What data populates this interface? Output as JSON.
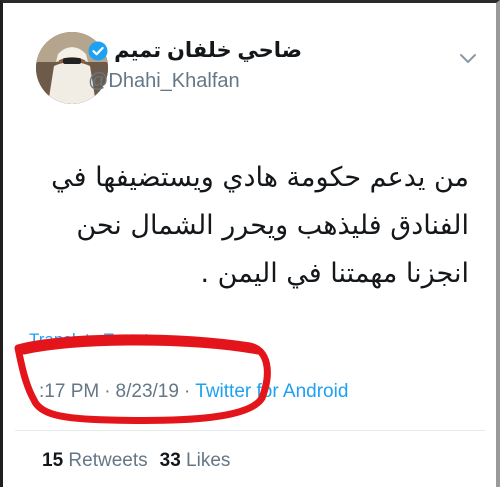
{
  "tweet": {
    "display_name": "ضاحي خلفان تميم",
    "handle": "@Dhahi_Khalfan",
    "verified_icon": "verified-badge-icon",
    "menu_icon": "chevron-down-icon",
    "body_lines": [
      "من يدعم حكومة هادي ويستضيفها في",
      "الفنادق فليذهب ويحرر الشمال نحن",
      "انجزنا مهمتنا في اليمن ."
    ],
    "translate_label": "Translate Tweet",
    "time": ":17 PM",
    "date": "8/23/19",
    "separator": "·",
    "source": "Twitter for Android",
    "retweets_count": "15",
    "retweets_label": "Retweets",
    "likes_count": "33",
    "likes_label": "Likes"
  },
  "colors": {
    "link_blue": "#1da1f2",
    "muted_gray": "#657786",
    "text": "#14171a",
    "annotation_red": "#e4141b"
  }
}
